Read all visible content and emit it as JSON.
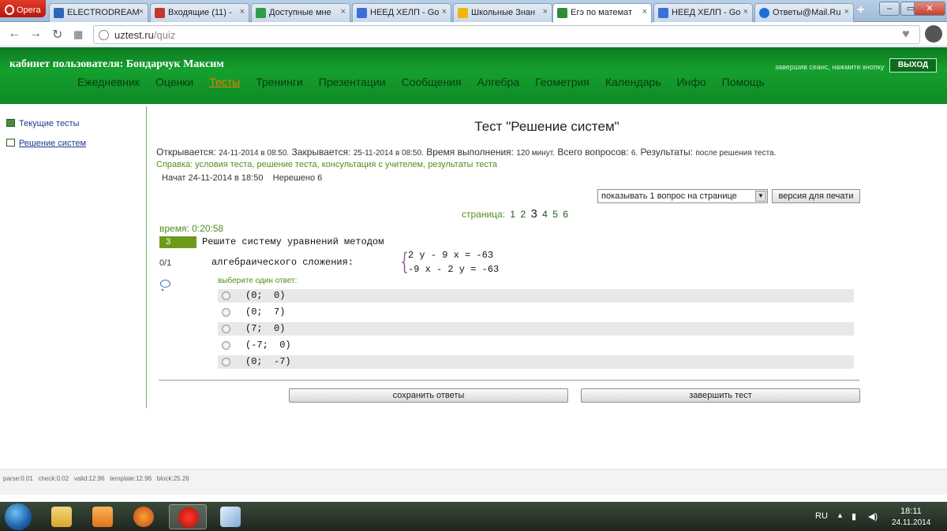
{
  "browser": {
    "opera_label": "Opera",
    "tabs": [
      {
        "label": "ELECTRODREAM",
        "color": "#2d67b8"
      },
      {
        "label": "Входящие (11) -",
        "color": "#c0392b"
      },
      {
        "label": "Доступные мне",
        "color": "#2e9d48"
      },
      {
        "label": "НЕЕД ХЕЛП - Go",
        "color": "#3a6fd8"
      },
      {
        "label": "Школьные Знан",
        "color": "#f2b705"
      },
      {
        "label": "Егэ по математ",
        "color": "#2a8f3a"
      },
      {
        "label": "НЕЕД ХЕЛП - Go",
        "color": "#3a6fd8"
      },
      {
        "label": "Ответы@Mail.Ru",
        "color": "#1d6fd8"
      }
    ],
    "new_tab": "+",
    "url_domain": "uztest.ru",
    "url_path": "/quiz"
  },
  "header": {
    "cabinet": "кабинет пользователя: Бондарчук Максим",
    "logout_note": "завершив сеанс, нажмите кнопку",
    "logout_button": "ВЫХОД",
    "nav": [
      "Ежедневник",
      "Оценки",
      "Тесты",
      "Тренинги",
      "Презентации",
      "Сообщения",
      "Алгебра",
      "Геометрия",
      "Календарь",
      "Инфо",
      "Помощь"
    ],
    "nav_active_index": 2,
    "colors": {
      "header_green": "#15a02e",
      "nav_active": "#f47a00"
    }
  },
  "sidebar": {
    "items": [
      "Текущие тесты",
      "Решение систем"
    ]
  },
  "test": {
    "title": "Тест \"Решение систем\"",
    "opens_label": "Открывается:",
    "opens": "24-11-2014 в 08:50.",
    "closes_label": "Закрывается:",
    "closes": "25-11-2014 в 08:50.",
    "duration_label": "Время выполнения:",
    "duration": "120 минут.",
    "questions_label": "Всего вопросов:",
    "questions": "6.",
    "results_label": "Результаты:",
    "results": "после решения теста.",
    "help": "Справка: условия теста, решение теста, консультация с учителем, результаты теста",
    "started": "Начат 24-11-2014 в 18:50    Нерешено 6",
    "per_page": "показывать 1 вопрос на странице",
    "print_button": "версия для печати",
    "pages_label": "страница:",
    "pages": [
      "1",
      "2",
      "3",
      "4",
      "5",
      "6"
    ],
    "current_page": 3,
    "timer": "время: 0:20:58",
    "question_number": "3",
    "question_line1": "Решите систему уравнений методом",
    "question_line2": "алгебраического сложения:",
    "equation1": "2 y - 9 x = -63",
    "equation2": "-9 x - 2 y = -63",
    "score": "0/1",
    "choose_label": "выберите один ответ:",
    "answers": [
      "(0;  0)",
      "(0;  7)",
      "(7;  0)",
      "(-7;  0)",
      "(0;  -7)"
    ],
    "save_button": "сохранить ответы",
    "finish_button": "завершить тест"
  },
  "footer": {
    "stats": "parse:0.01   check:0.02   valid:12.96   template:12.96   block:25.26"
  },
  "taskbar": {
    "lang": "RU",
    "time": "18:11",
    "date": "24.11.2014"
  }
}
